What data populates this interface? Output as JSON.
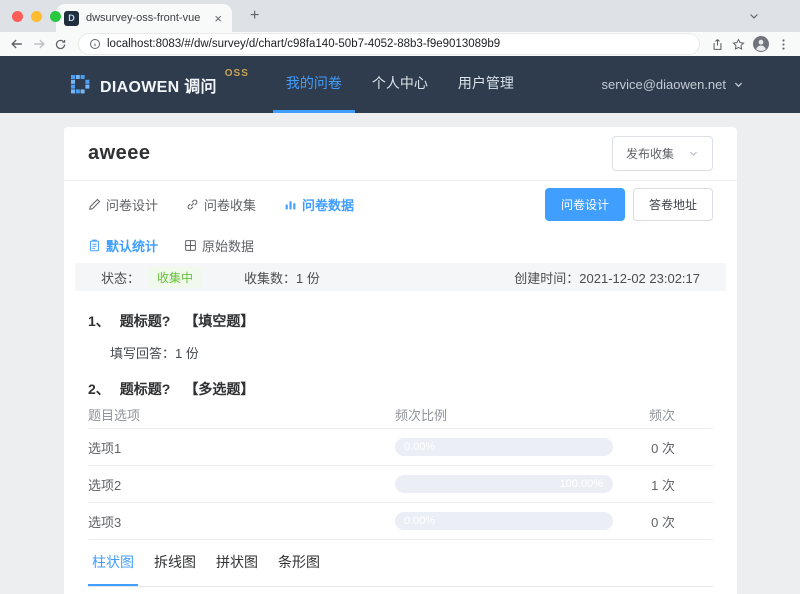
{
  "colors": {
    "accent": "#409eff",
    "header_bg": "#2e3c4d",
    "success_green": "#67c23a",
    "oss_gold": "#c9a353"
  },
  "browser": {
    "tab_title": "dwsurvey-oss-front-vue",
    "tab_close_glyph": "×",
    "new_tab_glyph": "+",
    "favicon_letter": "D",
    "url": "localhost:8083/#/dw/survey/d/chart/c98fa140-50b7-4052-88b3-f9e9013089b9"
  },
  "header": {
    "brand_name": "DIAOWEN 调问",
    "brand_badge": "OSS",
    "nav_items": [
      {
        "label": "我的问卷",
        "active": true
      },
      {
        "label": "个人中心",
        "active": false
      },
      {
        "label": "用户管理",
        "active": false
      }
    ],
    "account_email": "service@diaowen.net"
  },
  "survey": {
    "title": "aweee",
    "publish_dropdown_label": "发布收集",
    "tabs": [
      {
        "label": "问卷设计"
      },
      {
        "label": "问卷收集"
      },
      {
        "label": "问卷数据"
      }
    ],
    "design_button": "问卷设计",
    "answer_url_button": "答卷地址",
    "subtabs": [
      {
        "label": "默认统计"
      },
      {
        "label": "原始数据"
      }
    ],
    "status": {
      "status_label": "状态：",
      "status_value": "收集中",
      "count_label": "收集数：",
      "count_value": "1 份",
      "created_label": "创建时间：",
      "created_value": "2021-12-02 23:02:17"
    }
  },
  "questions": {
    "q1": {
      "number": "1、",
      "title": "题标题?",
      "type": "【填空题】",
      "answer_label": "填写回答：",
      "answer_value": "1 份"
    },
    "q2": {
      "number": "2、",
      "title": "题标题?",
      "type": "【多选题】"
    }
  },
  "chart_data": {
    "type": "table",
    "title": "题标题?【多选题】",
    "columns": [
      "题目选项",
      "频次比例",
      "频次"
    ],
    "rows": [
      {
        "option": "选项1",
        "percent": 0,
        "percent_label": "0.00%",
        "count": 0,
        "count_label": "0 次"
      },
      {
        "option": "选项2",
        "percent": 100,
        "percent_label": "100.00%",
        "count": 1,
        "count_label": "1 次"
      },
      {
        "option": "选项3",
        "percent": 0,
        "percent_label": "0.00%",
        "count": 0,
        "count_label": "0 次"
      }
    ]
  },
  "chart_tabs": [
    {
      "label": "柱状图",
      "active": true
    },
    {
      "label": "拆线图",
      "active": false
    },
    {
      "label": "拼状图",
      "active": false
    },
    {
      "label": "条形图",
      "active": false
    }
  ]
}
